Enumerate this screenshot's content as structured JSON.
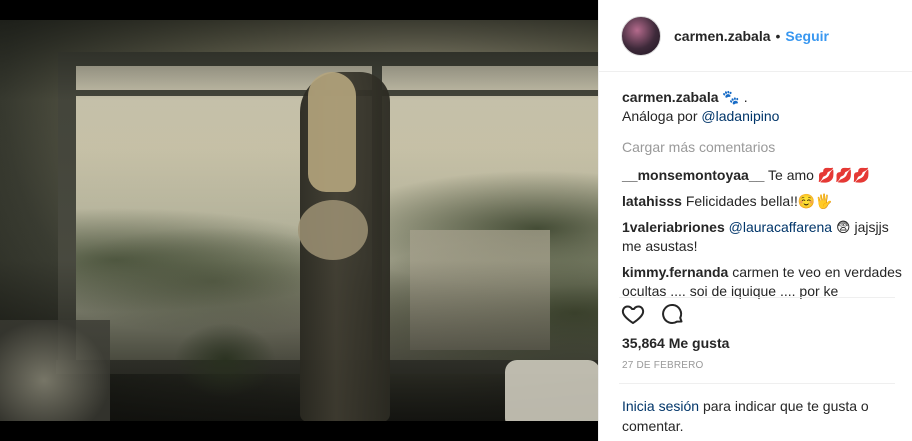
{
  "post": {
    "username": "carmen.zabala",
    "follow_label": "Seguir",
    "dot": "•"
  },
  "caption": {
    "username": "carmen.zabala",
    "emoji": "🐾 .",
    "line2_prefix": "Análoga por",
    "mention": "@ladanipino"
  },
  "load_more": "Cargar más comentarios",
  "comments": [
    {
      "user": "__monsemontoyaa__",
      "text": "Te amo 💋💋💋"
    },
    {
      "user": "latahisss",
      "text": "Felicidades bella!!☺️🖐"
    },
    {
      "user": "1valeriabriones",
      "mention": "@lauracaffarena",
      "text": "😨 jajsjjs me asustas!"
    },
    {
      "user": "kimmy.fernanda",
      "text": "carmen te veo en verdades ocultas .... soi de iquique .... por ke"
    }
  ],
  "likes": "35,864 Me gusta",
  "date": "27 DE FEBRERO",
  "login": {
    "link": "Inicia sesión",
    "text": "para indicar que te gusta o comentar."
  },
  "icons": {
    "like": "heart-icon",
    "comment": "comment-icon"
  }
}
